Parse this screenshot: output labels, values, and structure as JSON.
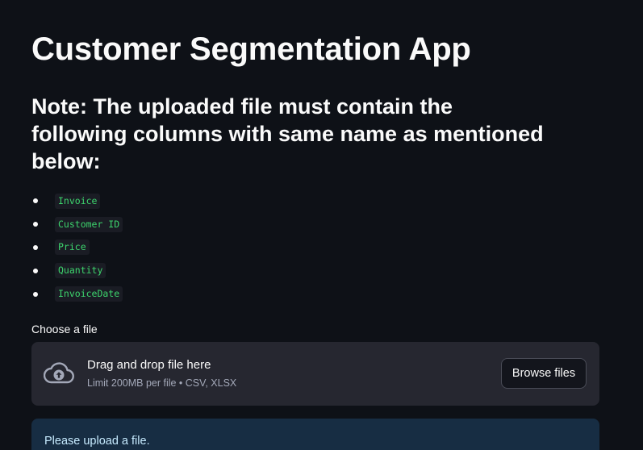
{
  "page": {
    "title": "Customer Segmentation App",
    "note": "Note: The uploaded file must contain the following columns with same name as mentioned below:"
  },
  "required_columns": [
    "Invoice",
    "Customer ID",
    "Price",
    "Quantity",
    "InvoiceDate"
  ],
  "uploader": {
    "label": "Choose a file",
    "drag_text": "Drag and drop file here",
    "limit_text": "Limit 200MB per file • CSV, XLSX",
    "browse_label": "Browse files",
    "icon": "cloud-upload-icon"
  },
  "info": {
    "message": "Please upload a file."
  },
  "colors": {
    "background": "#0e1117",
    "code_text": "#3dd56d",
    "dropzone": "#262730",
    "info_bg": "#172d43",
    "info_text": "#c7ebff"
  }
}
